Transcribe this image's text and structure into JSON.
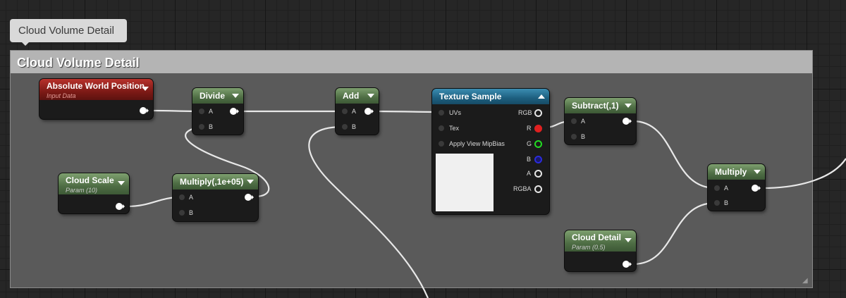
{
  "tooltip_tab": {
    "label": "Cloud Volume Detail"
  },
  "comment": {
    "title": "Cloud Volume Detail"
  },
  "nodes": {
    "absolute_world_position": {
      "title": "Absolute World Position",
      "subtitle": "Input Data"
    },
    "divide": {
      "title": "Divide",
      "pin_a": "A",
      "pin_b": "B"
    },
    "add": {
      "title": "Add",
      "pin_a": "A",
      "pin_b": "B"
    },
    "texture_sample": {
      "title": "Texture Sample",
      "inputs": [
        "UVs",
        "Tex",
        "Apply View MipBias"
      ],
      "outputs": [
        "RGB",
        "R",
        "G",
        "B",
        "A",
        "RGBA"
      ]
    },
    "subtract": {
      "title": "Subtract(,1)",
      "pin_a": "A",
      "pin_b": "B"
    },
    "cloud_scale": {
      "title": "Cloud Scale",
      "subtitle": "Param (10)"
    },
    "multiply_1e05": {
      "title": "Multiply(,1e+05)",
      "pin_a": "A",
      "pin_b": "B"
    },
    "multiply": {
      "title": "Multiply",
      "pin_a": "A",
      "pin_b": "B"
    },
    "cloud_detail": {
      "title": "Cloud Detail",
      "subtitle": "Param (0.5)"
    }
  },
  "colors": {
    "input_header": "#8b1f1b",
    "math_header": "#5b7a50",
    "texture_header": "#27739a",
    "param_header": "#5b7a50",
    "pin_r": "#e02020",
    "pin_g": "#22dd22",
    "pin_b": "#2b2bdd"
  }
}
